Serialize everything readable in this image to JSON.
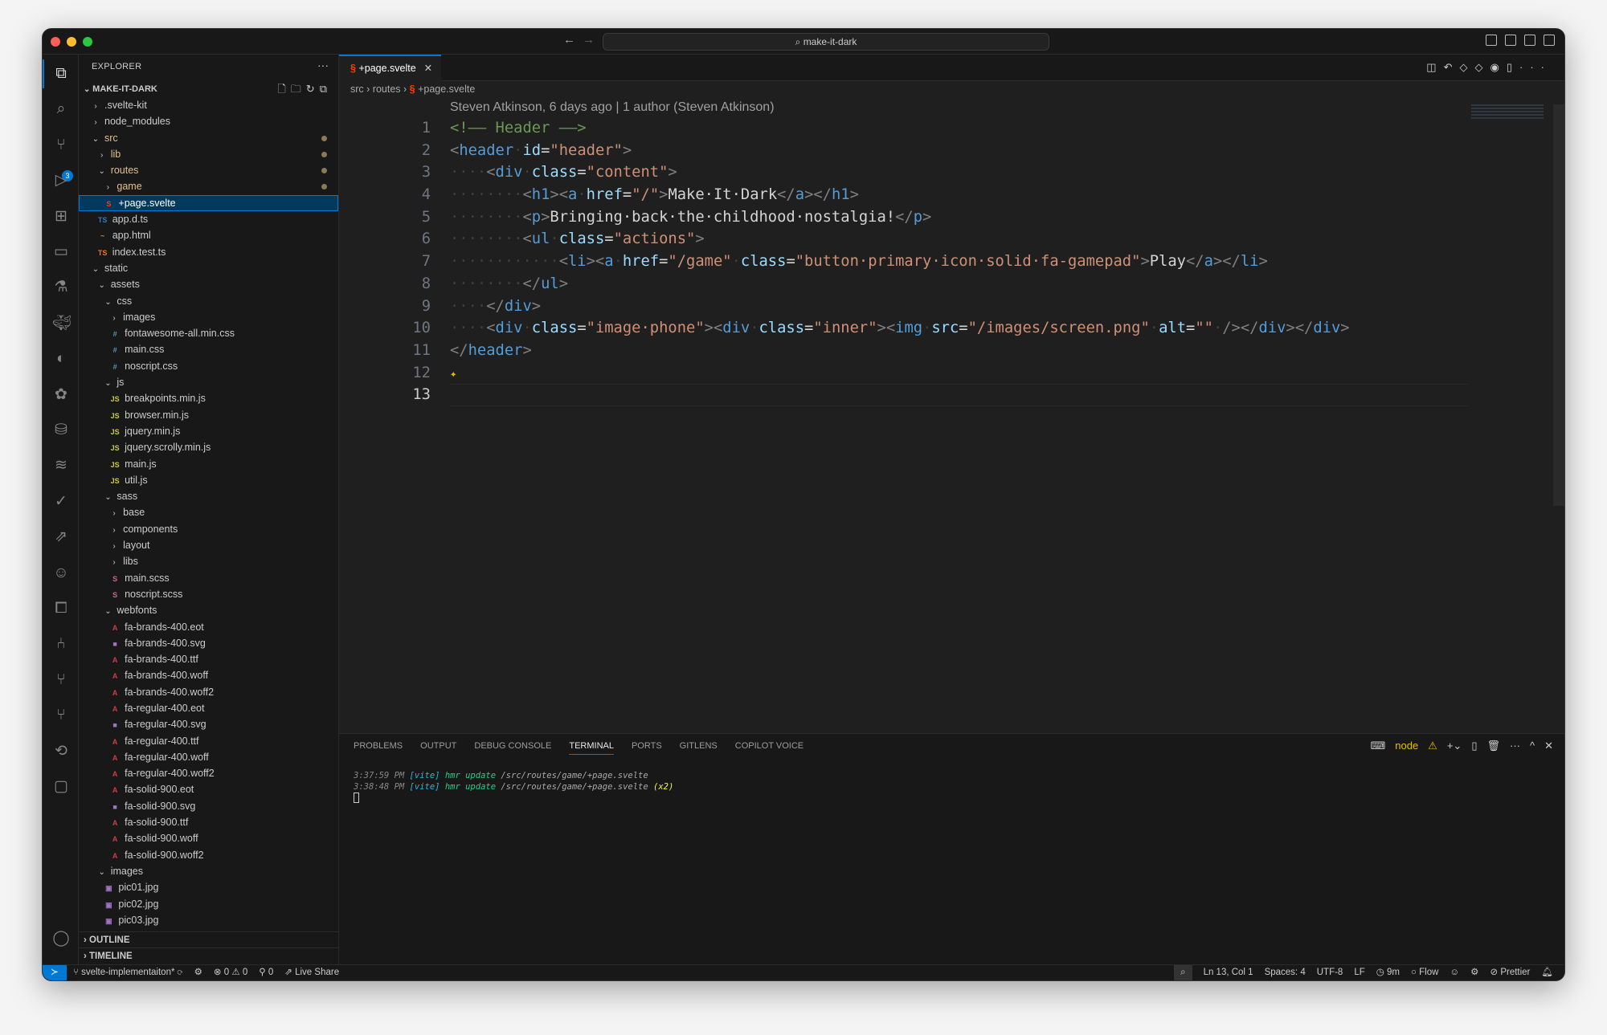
{
  "window": {
    "title": "make-it-dark",
    "traffic_colors": [
      "#ff5f57",
      "#febc2e",
      "#28c840"
    ]
  },
  "activity": {
    "icons": [
      "files-icon",
      "search-icon",
      "source-control-icon",
      "run-debug-icon",
      "extensions-icon",
      "remote-explorer-icon",
      "testing-icon",
      "docker-icon",
      "gitlens-icon",
      "paw-icon",
      "database-icon",
      "layers-icon",
      "check-shield-icon",
      "live-share-icon",
      "copilot-icon",
      "diagram-icon",
      "git-graph-icon",
      "branch-icon",
      "branch-alt-icon",
      "settings-sync-icon",
      "chat-icon"
    ],
    "scm_badge": "3",
    "bottom": [
      "account-icon",
      "gear-icon"
    ]
  },
  "sidebar": {
    "title": "EXPLORER",
    "more": "···",
    "project": "MAKE-IT-DARK",
    "tree": [
      {
        "d": 0,
        "c": ">",
        "n": ".svelte-kit"
      },
      {
        "d": 0,
        "c": ">",
        "n": "node_modules"
      },
      {
        "d": 0,
        "c": "v",
        "n": "src",
        "color": "#e2c08d",
        "git": true
      },
      {
        "d": 1,
        "c": ">",
        "n": "lib",
        "color": "#e2c08d",
        "git": true
      },
      {
        "d": 1,
        "c": "v",
        "n": "routes",
        "color": "#e2c08d",
        "git": true
      },
      {
        "d": 2,
        "c": ">",
        "n": "game",
        "color": "#e2c08d",
        "git": true
      },
      {
        "d": 2,
        "i": "S",
        "ic": "#ff3e00",
        "n": "+page.svelte",
        "sel": true,
        "color": "#ffffff"
      },
      {
        "d": 1,
        "i": "TS",
        "ic": "#3178c6",
        "n": "app.d.ts"
      },
      {
        "d": 1,
        "i": "~",
        "ic": "#e37933",
        "n": "app.html"
      },
      {
        "d": 1,
        "i": "TS",
        "ic": "#e37933",
        "n": "index.test.ts"
      },
      {
        "d": 0,
        "c": "v",
        "n": "static"
      },
      {
        "d": 1,
        "c": "v",
        "n": "assets"
      },
      {
        "d": 2,
        "c": "v",
        "n": "css"
      },
      {
        "d": 3,
        "c": ">",
        "n": "images"
      },
      {
        "d": 3,
        "i": "#",
        "ic": "#519aba",
        "n": "fontawesome-all.min.css"
      },
      {
        "d": 3,
        "i": "#",
        "ic": "#519aba",
        "n": "main.css"
      },
      {
        "d": 3,
        "i": "#",
        "ic": "#519aba",
        "n": "noscript.css"
      },
      {
        "d": 2,
        "c": "v",
        "n": "js"
      },
      {
        "d": 3,
        "i": "JS",
        "ic": "#cbcb41",
        "n": "breakpoints.min.js"
      },
      {
        "d": 3,
        "i": "JS",
        "ic": "#cbcb41",
        "n": "browser.min.js"
      },
      {
        "d": 3,
        "i": "JS",
        "ic": "#cbcb41",
        "n": "jquery.min.js"
      },
      {
        "d": 3,
        "i": "JS",
        "ic": "#cbcb41",
        "n": "jquery.scrolly.min.js"
      },
      {
        "d": 3,
        "i": "JS",
        "ic": "#cbcb41",
        "n": "main.js"
      },
      {
        "d": 3,
        "i": "JS",
        "ic": "#cbcb41",
        "n": "util.js"
      },
      {
        "d": 2,
        "c": "v",
        "n": "sass"
      },
      {
        "d": 3,
        "c": ">",
        "n": "base"
      },
      {
        "d": 3,
        "c": ">",
        "n": "components"
      },
      {
        "d": 3,
        "c": ">",
        "n": "layout"
      },
      {
        "d": 3,
        "c": ">",
        "n": "libs"
      },
      {
        "d": 3,
        "i": "S",
        "ic": "#cd6799",
        "n": "main.scss"
      },
      {
        "d": 3,
        "i": "S",
        "ic": "#cd6799",
        "n": "noscript.scss"
      },
      {
        "d": 2,
        "c": "v",
        "n": "webfonts"
      },
      {
        "d": 3,
        "i": "A",
        "ic": "#cc3e44",
        "n": "fa-brands-400.eot"
      },
      {
        "d": 3,
        "i": "■",
        "ic": "#a074c4",
        "n": "fa-brands-400.svg"
      },
      {
        "d": 3,
        "i": "A",
        "ic": "#cc3e44",
        "n": "fa-brands-400.ttf"
      },
      {
        "d": 3,
        "i": "A",
        "ic": "#cc3e44",
        "n": "fa-brands-400.woff"
      },
      {
        "d": 3,
        "i": "A",
        "ic": "#cc3e44",
        "n": "fa-brands-400.woff2"
      },
      {
        "d": 3,
        "i": "A",
        "ic": "#cc3e44",
        "n": "fa-regular-400.eot"
      },
      {
        "d": 3,
        "i": "■",
        "ic": "#a074c4",
        "n": "fa-regular-400.svg"
      },
      {
        "d": 3,
        "i": "A",
        "ic": "#cc3e44",
        "n": "fa-regular-400.ttf"
      },
      {
        "d": 3,
        "i": "A",
        "ic": "#cc3e44",
        "n": "fa-regular-400.woff"
      },
      {
        "d": 3,
        "i": "A",
        "ic": "#cc3e44",
        "n": "fa-regular-400.woff2"
      },
      {
        "d": 3,
        "i": "A",
        "ic": "#cc3e44",
        "n": "fa-solid-900.eot"
      },
      {
        "d": 3,
        "i": "■",
        "ic": "#a074c4",
        "n": "fa-solid-900.svg"
      },
      {
        "d": 3,
        "i": "A",
        "ic": "#cc3e44",
        "n": "fa-solid-900.ttf"
      },
      {
        "d": 3,
        "i": "A",
        "ic": "#cc3e44",
        "n": "fa-solid-900.woff"
      },
      {
        "d": 3,
        "i": "A",
        "ic": "#cc3e44",
        "n": "fa-solid-900.woff2"
      },
      {
        "d": 1,
        "c": "v",
        "n": "images"
      },
      {
        "d": 2,
        "i": "▣",
        "ic": "#a074c4",
        "n": "pic01.jpg"
      },
      {
        "d": 2,
        "i": "▣",
        "ic": "#a074c4",
        "n": "pic02.jpg"
      },
      {
        "d": 2,
        "i": "▣",
        "ic": "#a074c4",
        "n": "pic03.jpg"
      }
    ],
    "outline": "OUTLINE",
    "timeline": "TIMELINE"
  },
  "editor": {
    "tab": "+page.svelte",
    "breadcrumb": [
      "src",
      "routes",
      "+page.svelte"
    ],
    "blame": "Steven Atkinson, 6 days ago | 1 author (Steven Atkinson)",
    "current_line": 13,
    "lines": [
      [
        [
          "cm",
          "<!—— Header ——>"
        ]
      ],
      [
        [
          "br",
          "<"
        ],
        [
          "tg",
          "header"
        ],
        [
          "ws",
          "·"
        ],
        [
          "at",
          "id"
        ],
        [
          "tx",
          "="
        ],
        [
          "st",
          "\"header\""
        ],
        [
          "br",
          ">"
        ]
      ],
      [
        [
          "ws",
          "····"
        ],
        [
          "br",
          "<"
        ],
        [
          "tg",
          "div"
        ],
        [
          "ws",
          "·"
        ],
        [
          "at",
          "class"
        ],
        [
          "tx",
          "="
        ],
        [
          "st",
          "\"content\""
        ],
        [
          "br",
          ">"
        ]
      ],
      [
        [
          "ws",
          "········"
        ],
        [
          "br",
          "<"
        ],
        [
          "tg",
          "h1"
        ],
        [
          "br",
          "><"
        ],
        [
          "tg",
          "a"
        ],
        [
          "ws",
          "·"
        ],
        [
          "at",
          "href"
        ],
        [
          "tx",
          "="
        ],
        [
          "st",
          "\"/\""
        ],
        [
          "br",
          ">"
        ],
        [
          "tx",
          "Make·It·Dark"
        ],
        [
          "br",
          "</"
        ],
        [
          "tg",
          "a"
        ],
        [
          "br",
          "></"
        ],
        [
          "tg",
          "h1"
        ],
        [
          "br",
          ">"
        ]
      ],
      [
        [
          "ws",
          "········"
        ],
        [
          "br",
          "<"
        ],
        [
          "tg",
          "p"
        ],
        [
          "br",
          ">"
        ],
        [
          "tx",
          "Bringing·back·the·childhood·nostalgia!"
        ],
        [
          "br",
          "</"
        ],
        [
          "tg",
          "p"
        ],
        [
          "br",
          ">"
        ]
      ],
      [
        [
          "ws",
          "········"
        ],
        [
          "br",
          "<"
        ],
        [
          "tg",
          "ul"
        ],
        [
          "ws",
          "·"
        ],
        [
          "at",
          "class"
        ],
        [
          "tx",
          "="
        ],
        [
          "st",
          "\"actions\""
        ],
        [
          "br",
          ">"
        ]
      ],
      [
        [
          "ws",
          "············"
        ],
        [
          "br",
          "<"
        ],
        [
          "tg",
          "li"
        ],
        [
          "br",
          "><"
        ],
        [
          "tg",
          "a"
        ],
        [
          "ws",
          "·"
        ],
        [
          "at",
          "href"
        ],
        [
          "tx",
          "="
        ],
        [
          "st",
          "\"/game\""
        ],
        [
          "ws",
          "·"
        ],
        [
          "at",
          "class"
        ],
        [
          "tx",
          "="
        ],
        [
          "st",
          "\"button·primary·icon·solid·fa-gamepad\""
        ],
        [
          "br",
          ">"
        ],
        [
          "tx",
          "Play"
        ],
        [
          "br",
          "</"
        ],
        [
          "tg",
          "a"
        ],
        [
          "br",
          "></"
        ],
        [
          "tg",
          "li"
        ],
        [
          "br",
          ">"
        ]
      ],
      [
        [
          "ws",
          "········"
        ],
        [
          "br",
          "</"
        ],
        [
          "tg",
          "ul"
        ],
        [
          "br",
          ">"
        ]
      ],
      [
        [
          "ws",
          "····"
        ],
        [
          "br",
          "</"
        ],
        [
          "tg",
          "div"
        ],
        [
          "br",
          ">"
        ]
      ],
      [
        [
          "ws",
          "····"
        ],
        [
          "br",
          "<"
        ],
        [
          "tg",
          "div"
        ],
        [
          "ws",
          "·"
        ],
        [
          "at",
          "class"
        ],
        [
          "tx",
          "="
        ],
        [
          "st",
          "\"image·phone\""
        ],
        [
          "br",
          "><"
        ],
        [
          "tg",
          "div"
        ],
        [
          "ws",
          "·"
        ],
        [
          "at",
          "class"
        ],
        [
          "tx",
          "="
        ],
        [
          "st",
          "\"inner\""
        ],
        [
          "br",
          "><"
        ],
        [
          "tg",
          "img"
        ],
        [
          "ws",
          "·"
        ],
        [
          "at",
          "src"
        ],
        [
          "tx",
          "="
        ],
        [
          "st",
          "\"/images/screen.png\""
        ],
        [
          "ws",
          "·"
        ],
        [
          "at",
          "alt"
        ],
        [
          "tx",
          "="
        ],
        [
          "st",
          "\"\""
        ],
        [
          "ws",
          "·"
        ],
        [
          "br",
          "/></"
        ],
        [
          "tg",
          "div"
        ],
        [
          "br",
          "></"
        ],
        [
          "tg",
          "div"
        ],
        [
          "br",
          ">"
        ]
      ],
      [
        [
          "br",
          "</"
        ],
        [
          "tg",
          "header"
        ],
        [
          "br",
          ">"
        ]
      ],
      [
        [
          "sp",
          "✦"
        ]
      ],
      []
    ]
  },
  "panel": {
    "tabs": [
      "PROBLEMS",
      "OUTPUT",
      "DEBUG CONSOLE",
      "TERMINAL",
      "PORTS",
      "GITLENS",
      "COPILOT VOICE"
    ],
    "active_tab": "TERMINAL",
    "shell": "node",
    "terminal": [
      {
        "time": "3:37:59 PM",
        "tag": "[vite]",
        "msg": "hmr update",
        "path": "/src/routes/game/+page.svelte",
        "extra": ""
      },
      {
        "time": "3:38:48 PM",
        "tag": "[vite]",
        "msg": "hmr update",
        "path": "/src/routes/game/+page.svelte",
        "extra": "(x2)"
      }
    ]
  },
  "status": {
    "branch": "svelte-implementaiton*",
    "errors": "0",
    "warnings": "0",
    "ports": "0",
    "live_share": "Live Share",
    "position": "Ln 13, Col 1",
    "spaces": "Spaces: 4",
    "encoding": "UTF-8",
    "eol": "LF",
    "time": "9m",
    "flow": "Flow",
    "prettier": "Prettier"
  }
}
